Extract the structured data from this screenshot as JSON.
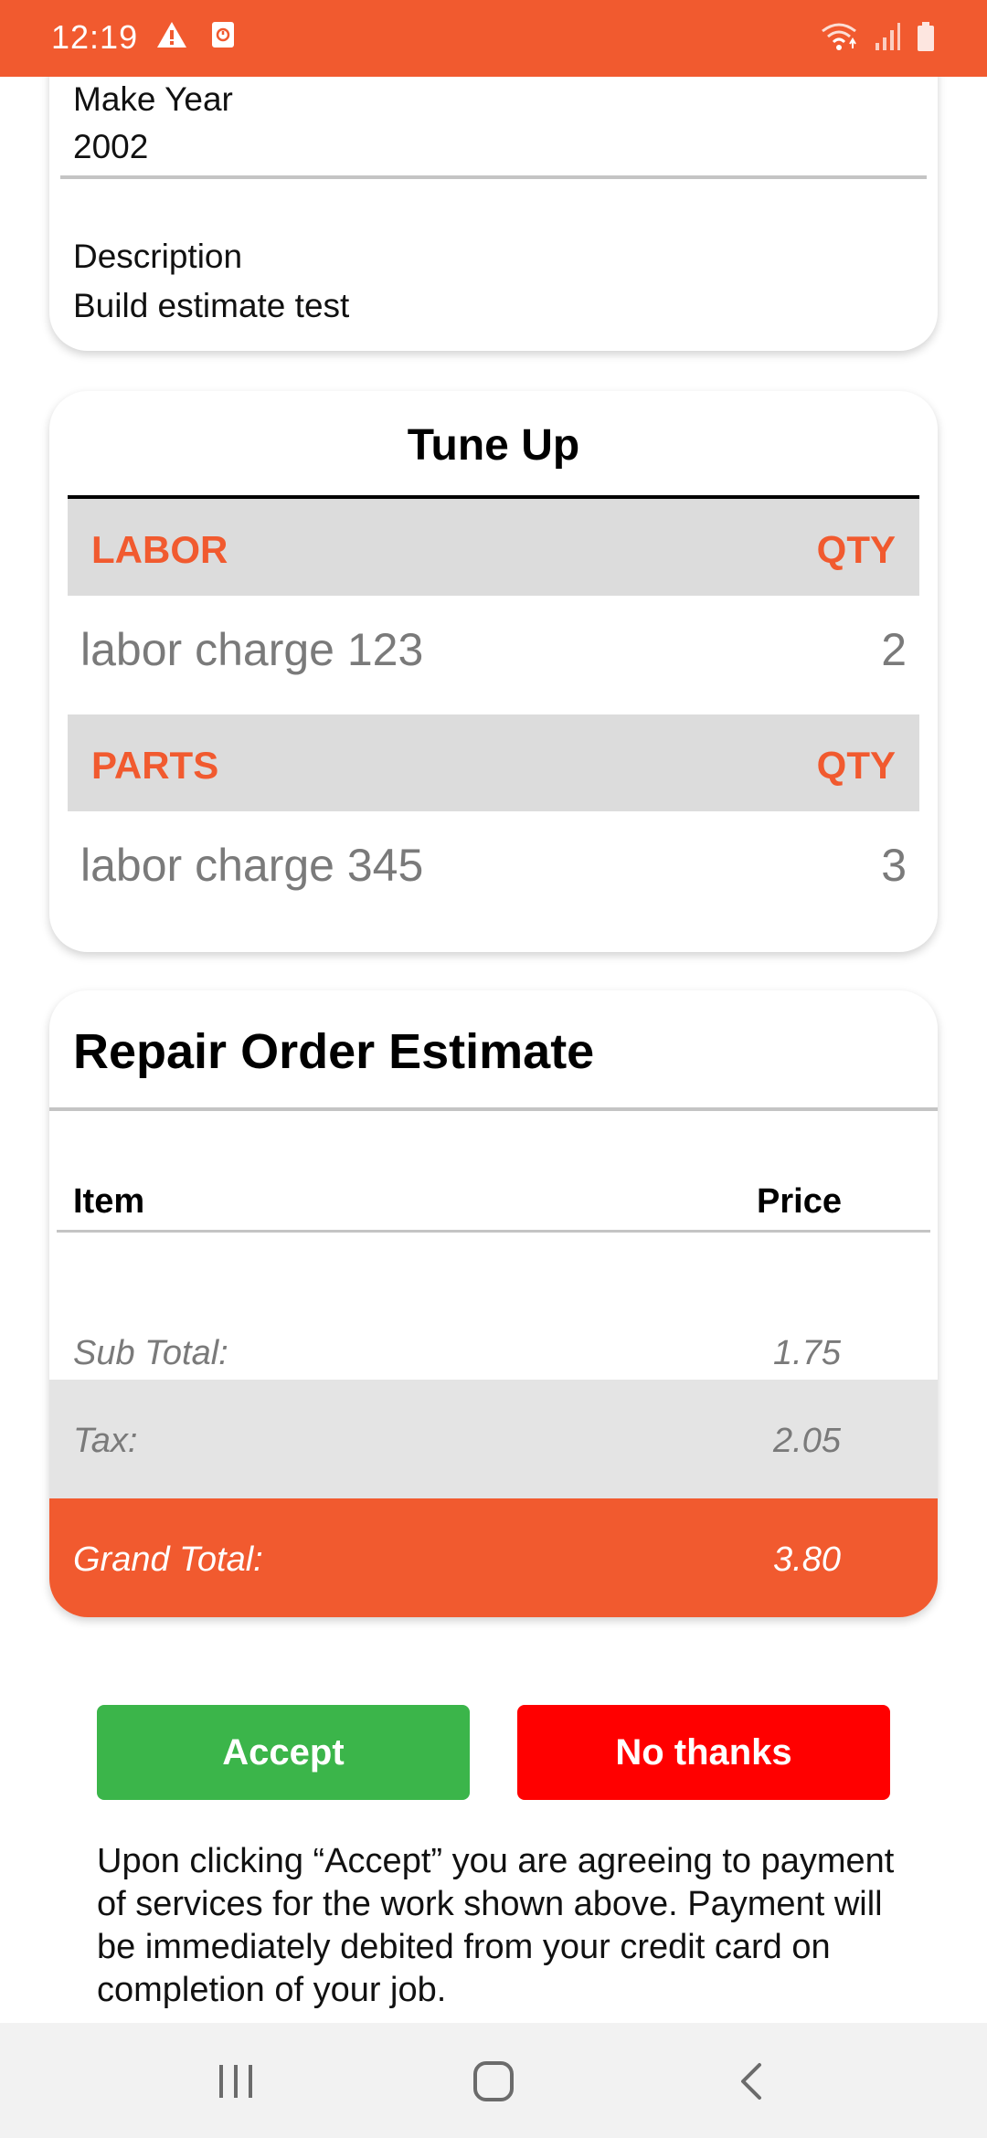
{
  "status_bar": {
    "time": "12:19",
    "left_icons": [
      "warning-icon",
      "alarm-icon"
    ],
    "right_icons": [
      "wifi-icon",
      "signal-icon",
      "battery-icon"
    ],
    "accent_color": "#f15a2f"
  },
  "vehicle": {
    "make_year_label": "Make Year",
    "make_year_value": "2002",
    "description_label": "Description",
    "description_value": "Build estimate test"
  },
  "service": {
    "title": "Tune Up",
    "labor_header": "LABOR",
    "labor_qty_header": "QTY",
    "labor_items": [
      {
        "name": "labor charge 123",
        "qty": "2"
      }
    ],
    "parts_header": "PARTS",
    "parts_qty_header": "QTY",
    "parts_items": [
      {
        "name": "labor charge 345",
        "qty": "3"
      }
    ]
  },
  "estimate": {
    "title": "Repair Order Estimate",
    "col_item": "Item",
    "col_price": "Price",
    "sub_total_label": "Sub Total:",
    "sub_total_value": "1.75",
    "tax_label": "Tax:",
    "tax_value": "2.05",
    "grand_total_label": "Grand Total:",
    "grand_total_value": "3.80"
  },
  "actions": {
    "accept_label": "Accept",
    "decline_label": "No thanks",
    "accept_color": "#3bb54a",
    "decline_color": "#ff0000"
  },
  "disclaimer": "Upon clicking “Accept” you are agreeing to payment of services for the work shown above. Payment will be immediately debited from your credit card on completion of your job.",
  "nav_bar": {
    "icons": [
      "recent-apps-icon",
      "home-icon",
      "back-icon"
    ]
  }
}
